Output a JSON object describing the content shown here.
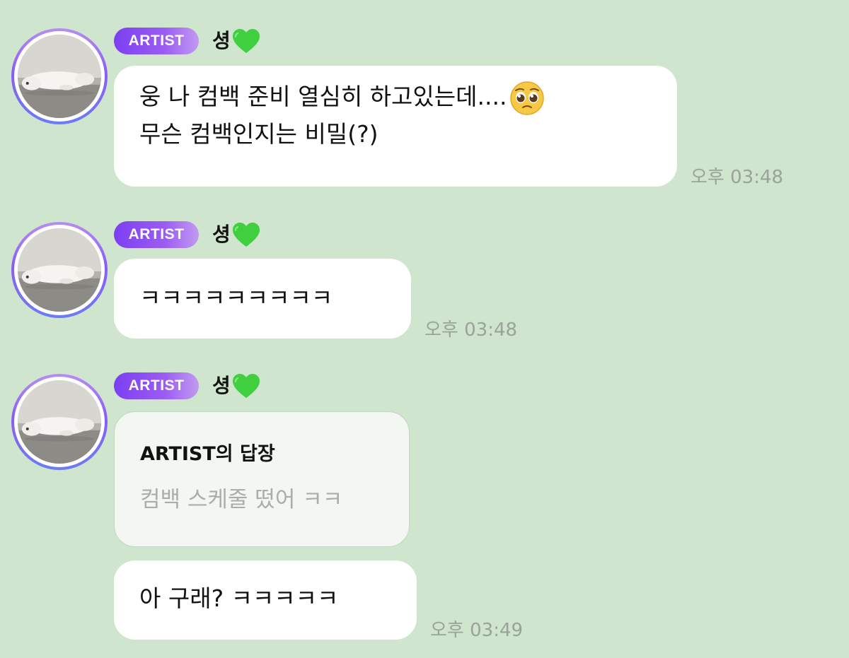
{
  "colors": {
    "background": "#cfe5cd",
    "bubble": "#ffffff",
    "reply_bubble": "#f3f7f1",
    "badge_start": "#7b3ff2",
    "badge_end": "#c19bf0",
    "timestamp": "#9aa39a",
    "heart": "#3fcf3f"
  },
  "messages": [
    {
      "badge": "ARTIST",
      "sender": "셩",
      "sender_icon": "green-heart-icon",
      "lines": [
        "웅 나 컴백 준비 열심히 하고있는데....",
        "무슨 컴백인지는 비밀(?)"
      ],
      "line1_emoji": "pleading-face-icon",
      "time": "오후 03:48"
    },
    {
      "badge": "ARTIST",
      "sender": "셩",
      "sender_icon": "green-heart-icon",
      "text": "ㅋㅋㅋㅋㅋㅋㅋㅋㅋ",
      "time": "오후 03:48"
    },
    {
      "badge": "ARTIST",
      "sender": "셩",
      "sender_icon": "green-heart-icon",
      "reply": {
        "title": "ARTIST의 답장",
        "quote": "컴백 스케줄 떴어 ㅋㅋ"
      },
      "text": "아 구래? ㅋㅋㅋㅋㅋ",
      "time": "오후 03:49"
    }
  ]
}
